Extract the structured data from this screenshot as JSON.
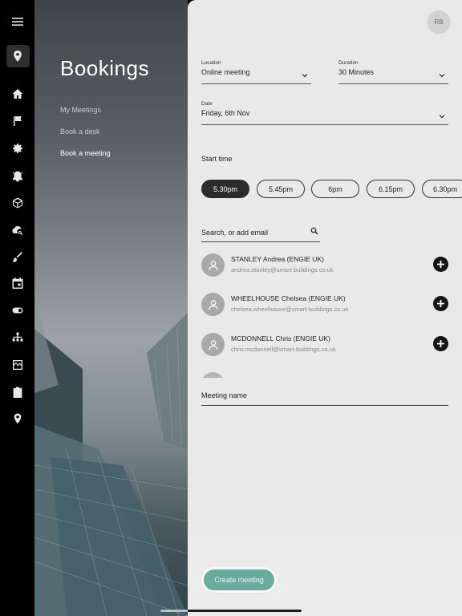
{
  "sidebar": {
    "icons": [
      "menu-icon",
      "location-pin-icon",
      "home-icon",
      "flag-icon",
      "gear-icon",
      "alarm-icon",
      "cube-icon",
      "cloud-search-icon",
      "brush-icon",
      "calendar-icon",
      "toggle-icon",
      "hierarchy-icon",
      "monitoring-icon",
      "clipboard-icon",
      "map-marker-icon"
    ]
  },
  "page": {
    "title": "Bookings",
    "nav": [
      {
        "label": "My Meetings"
      },
      {
        "label": "Book a desk"
      },
      {
        "label": "Book a meeting"
      }
    ]
  },
  "user": {
    "initials": "RB"
  },
  "form": {
    "location": {
      "label": "Location",
      "value": "Online meeting"
    },
    "duration": {
      "label": "Duration",
      "value": "30 Minutes"
    },
    "date": {
      "label": "Date",
      "value": "Friday, 6th Nov"
    },
    "start_time_label": "Start time",
    "times": [
      "5.30pm",
      "5.45pm",
      "6pm",
      "6.15pm",
      "6.30pm"
    ],
    "selected_time": "5.30pm",
    "search_placeholder": "Search, or add email",
    "people": [
      {
        "name": "STANLEY Andrea (ENGIE UK)",
        "email": "andrea.stanley@smart-buildings.co.uk"
      },
      {
        "name": "WHEELHOUSE Chelsea (ENGIE UK)",
        "email": "chelsea.wheelhouse@smart-buildings.co.uk"
      },
      {
        "name": "MCDONNELL Chris (ENGIE UK)",
        "email": "chris.mcdonnell@smart-buildings.co.uk"
      }
    ],
    "meeting_name_label": "Meeting name",
    "create_button": "Create meeting"
  },
  "colors": {
    "accent": "#6aaba0",
    "selected_pill": "#2b2b2b"
  }
}
